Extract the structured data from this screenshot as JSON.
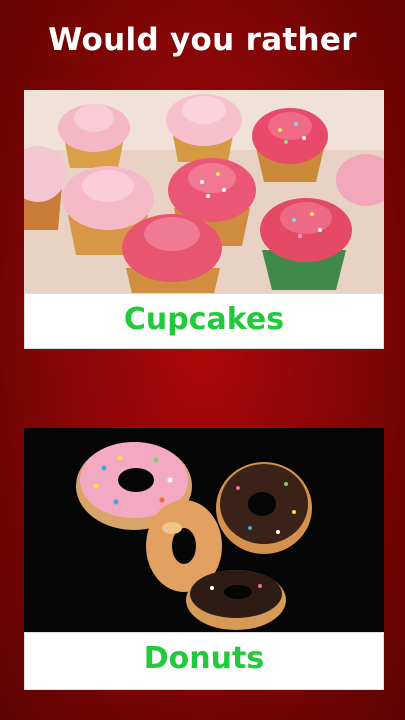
{
  "header": {
    "title": "Would you rather"
  },
  "options": [
    {
      "label": "Cupcakes",
      "image": "cupcakes-photo"
    },
    {
      "label": "Donuts",
      "image": "donuts-photo"
    }
  ],
  "colors": {
    "background": "#8a0606",
    "label_text": "#22c93a",
    "title_text": "#ffffff"
  }
}
